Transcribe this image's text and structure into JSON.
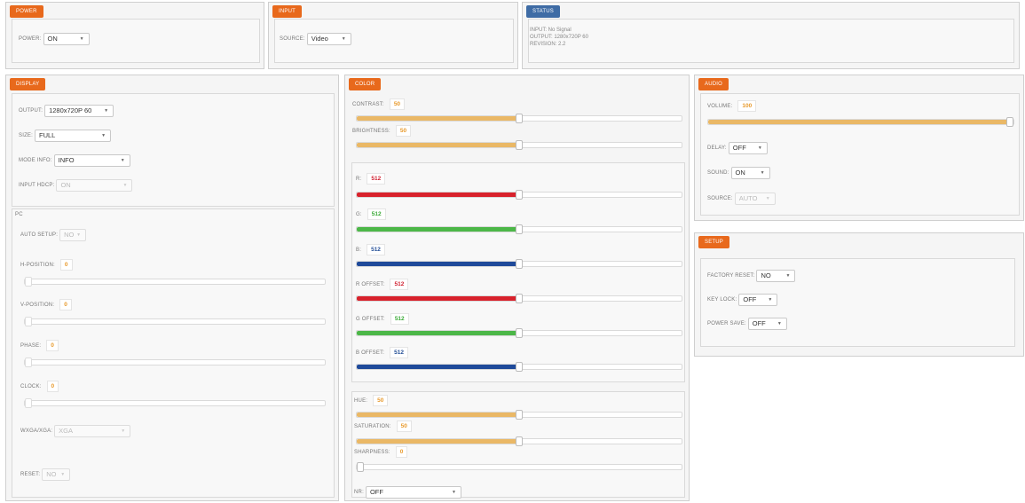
{
  "power": {
    "title": "POWER",
    "label": "POWER:",
    "value": "ON"
  },
  "input": {
    "title": "INPUT",
    "label": "SOURCE:",
    "value": "Video"
  },
  "status": {
    "title": "STATUS",
    "lines": [
      "INPUT: No Signal",
      "OUTPUT: 1280x720P 60",
      "REVISION: 2.2"
    ]
  },
  "display": {
    "title": "DISPLAY",
    "output_label": "OUTPUT:",
    "output_value": "1280x720P 60",
    "size_label": "SIZE:",
    "size_value": "FULL",
    "mode_label": "MODE INFO:",
    "mode_value": "INFO",
    "hdcp_label": "INPUT HDCP:",
    "hdcp_value": "ON",
    "pc": {
      "title": "PC",
      "auto_label": "AUTO SETUP:",
      "auto_value": "NO",
      "hpos_label": "H-POSITION:",
      "hpos_value": "0",
      "hpos_level": 0,
      "vpos_label": "V-POSITION:",
      "vpos_value": "0",
      "vpos_level": 0,
      "phase_label": "PHASE:",
      "phase_value": "0",
      "phase_level": 0,
      "clock_label": "CLOCK:",
      "clock_value": "0",
      "clock_level": 0,
      "wxga_label": "WXGA/XGA:",
      "wxga_value": "XGA",
      "reset_label": "RESET:",
      "reset_value": "NO"
    }
  },
  "color": {
    "title": "COLOR",
    "contrast_label": "CONTRAST:",
    "contrast_value": "50",
    "contrast_level": 0.5,
    "brightness_label": "BRIGHTNESS:",
    "brightness_value": "50",
    "brightness_level": 0.5,
    "r_label": "R:",
    "r_value": "512",
    "r_level": 0.5,
    "g_label": "G:",
    "g_value": "512",
    "g_level": 0.5,
    "b_label": "B:",
    "b_value": "512",
    "b_level": 0.5,
    "roff_label": "R OFFSET:",
    "roff_value": "512",
    "roff_level": 0.5,
    "goff_label": "G OFFSET:",
    "goff_value": "512",
    "goff_level": 0.5,
    "boff_label": "B OFFSET:",
    "boff_value": "512",
    "boff_level": 0.5,
    "hue_label": "HUE:",
    "hue_value": "50",
    "hue_level": 0.5,
    "sat_label": "SATURATION:",
    "sat_value": "50",
    "sat_level": 0.5,
    "sharp_label": "SHARPNESS:",
    "sharp_value": "0",
    "sharp_level": 0,
    "nr_label": "NR:",
    "nr_value": "OFF"
  },
  "audio": {
    "title": "AUDIO",
    "volume_label": "VOLUME:",
    "volume_value": "100",
    "volume_level": 1,
    "delay_label": "DELAY:",
    "delay_value": "OFF",
    "sound_label": "SOUND:",
    "sound_value": "ON",
    "source_label": "SOURCE:",
    "source_value": "AUTO"
  },
  "setup": {
    "title": "SETUP",
    "reset_label": "FACTORY RESET:",
    "reset_value": "NO",
    "keylock_label": "KEY LOCK:",
    "keylock_value": "OFF",
    "powersave_label": "POWER SAVE:",
    "powersave_value": "OFF"
  },
  "colors": {
    "orange": "#e8691c",
    "blue": "#3f6ca5",
    "slider_orange": "#eab866",
    "red": "#d8222c",
    "green": "#4cb748",
    "navy": "#1f4a9a"
  },
  "icons": {
    "caret": "caret-down-icon"
  }
}
